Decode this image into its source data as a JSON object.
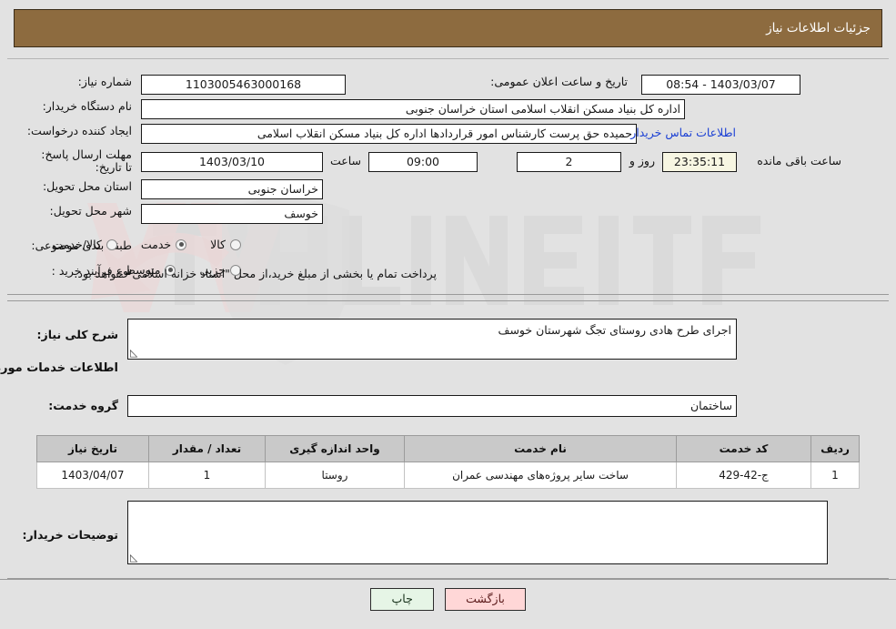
{
  "header": {
    "title": "جزئیات اطلاعات نیاز"
  },
  "form": {
    "need_number_label": "شماره نیاز:",
    "need_number_value": "1103005463000168",
    "public_announce_label": "تاریخ و ساعت اعلان عمومی:",
    "public_announce_value": "1403/03/07 - 08:54",
    "buyer_org_label": "نام دستگاه خریدار:",
    "buyer_org_value": "اداره کل بنیاد مسکن انقلاب اسلامی استان خراسان جنوبی",
    "creator_label": "ایجاد کننده درخواست:",
    "creator_value": "حمیده حق پرست کارشناس امور قراردادها اداره کل بنیاد مسکن انقلاب اسلامی",
    "contact_link": "اطلاعات تماس خریدار",
    "deadline_label": "مهلت ارسال پاسخ: تا تاریخ:",
    "deadline_date": "1403/03/10",
    "deadline_hour_label": "ساعت",
    "deadline_hour": "09:00",
    "remaining_days": "2",
    "remaining_days_suffix": "روز و",
    "remaining_time": "23:35:11",
    "remaining_time_suffix": "ساعت باقی مانده",
    "province_label": "استان محل تحویل:",
    "province_value": "خراسان جنوبی",
    "city_label": "شهر محل تحویل:",
    "city_value": "خوسف",
    "category_label": "طبقه بندی موضوعی:",
    "category_options": [
      {
        "label": "کالا",
        "selected": false
      },
      {
        "label": "خدمت",
        "selected": true
      },
      {
        "label": "کالا/خدمت",
        "selected": false
      }
    ],
    "process_label": "نوع فرآیند خرید :",
    "process_options": [
      {
        "label": "جزیی",
        "selected": false
      },
      {
        "label": "متوسط",
        "selected": true
      }
    ],
    "treasury_note": "پرداخت تمام یا بخشی از مبلغ خرید،از محل \"اسناد خزانه اسلامی\" خواهد بود."
  },
  "description": {
    "label": "شرح کلی نیاز:",
    "value": "اجرای طرح هادی روستای تجگ شهرستان خوسف"
  },
  "services_section": {
    "heading": "اطلاعات خدمات مورد نیاز",
    "group_label": "گروه خدمت:",
    "group_value": "ساختمان"
  },
  "table": {
    "headers": [
      "ردیف",
      "کد خدمت",
      "نام خدمت",
      "واحد اندازه گیری",
      "تعداد / مقدار",
      "تاریخ نیاز"
    ],
    "rows": [
      {
        "row": "1",
        "service_code": "ج-42-429",
        "service_name": "ساخت سایر پروژه‌های مهندسی عمران",
        "unit": "روستا",
        "quantity": "1",
        "need_date": "1403/04/07"
      }
    ]
  },
  "buyer_notes": {
    "label": "توضیحات خریدار:",
    "value": ""
  },
  "footer": {
    "back_label": "بازگشت",
    "print_label": "چاپ"
  },
  "colors": {
    "header_brown": "#8d6b3f",
    "page_background": "#e2e2e2",
    "link_blue": "#1a3fd4",
    "back_button": "#ffd7d7",
    "print_button": "#e6f5e6",
    "table_header": "#c9c9c9",
    "countdown_cream": "#f7f6e2"
  }
}
